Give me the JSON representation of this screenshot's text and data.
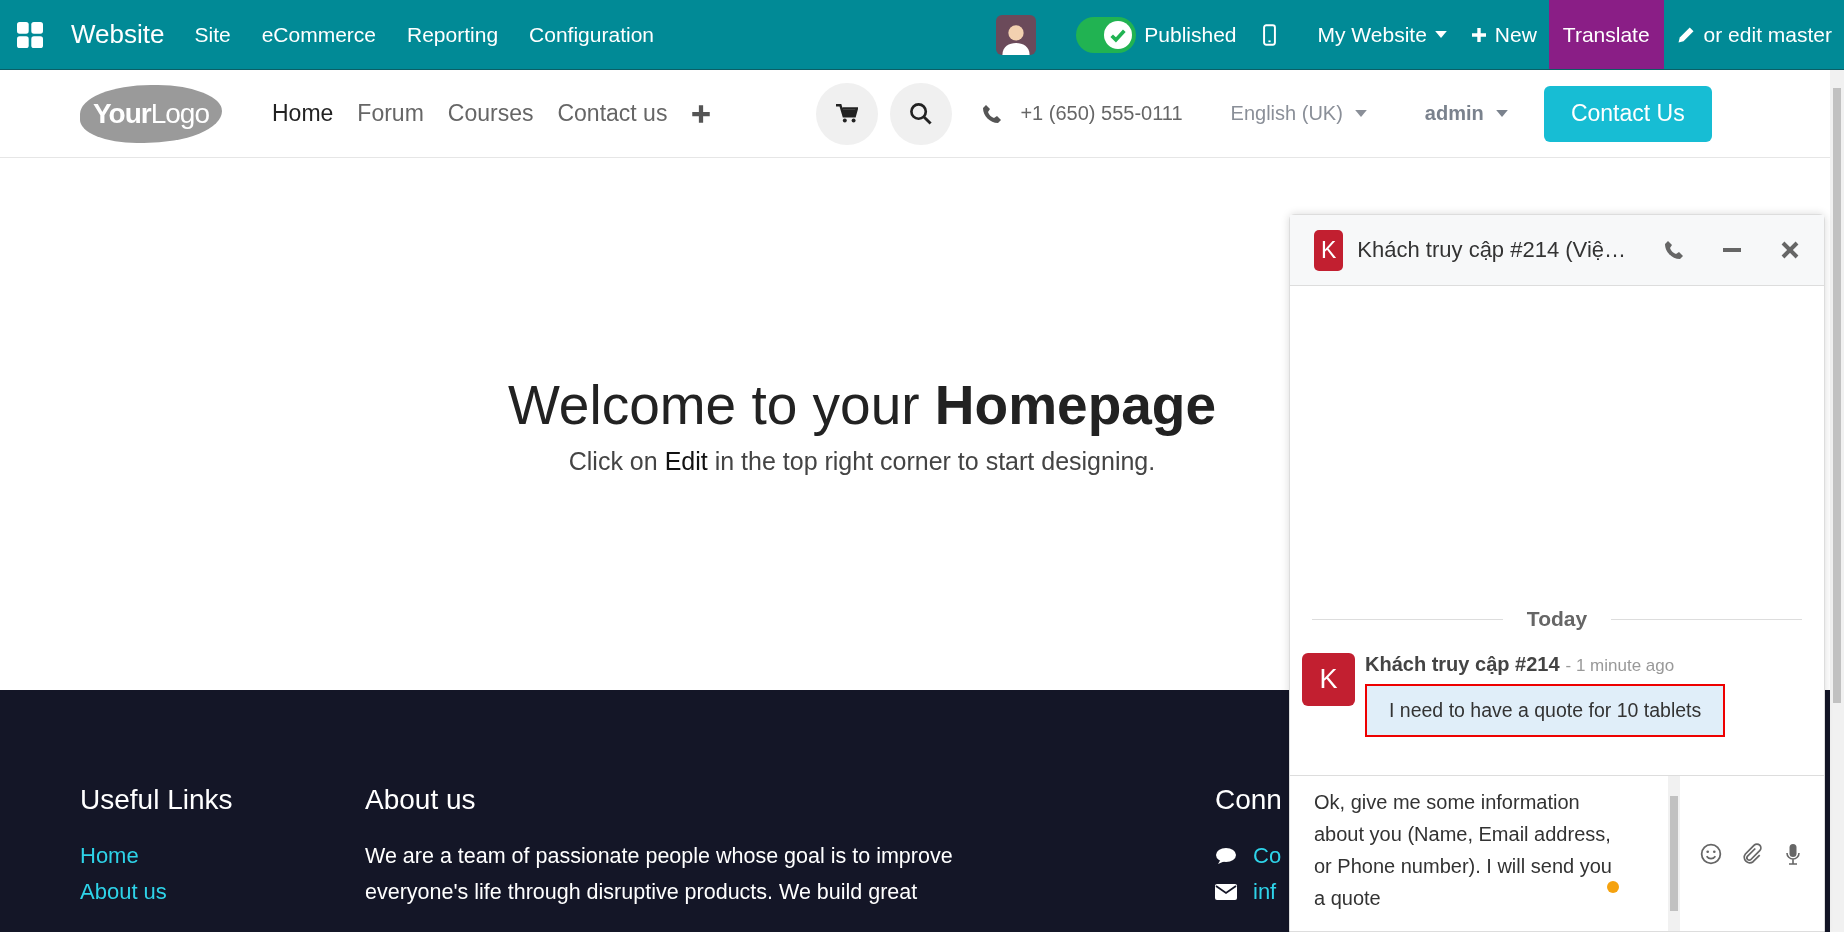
{
  "topbar": {
    "app_name": "Website",
    "menu": [
      "Site",
      "eCommerce",
      "Reporting",
      "Configuration"
    ],
    "published": {
      "label": "Published",
      "on": true
    },
    "website_selector": "My Website",
    "new_button": "New",
    "translate_button": "Translate",
    "edit_master_button": "or edit master"
  },
  "header": {
    "logo": "**Your**Logo",
    "nav": [
      {
        "label": "Home",
        "selected": true
      },
      {
        "label": "Forum",
        "selected": false
      },
      {
        "label": "Courses",
        "selected": false
      },
      {
        "label": "Contact us",
        "selected": false
      }
    ],
    "phone": "+1 (650) 555-0111",
    "language": "English (UK)",
    "user": "admin",
    "contact_button": "Contact Us"
  },
  "hero": {
    "title": "Welcome to your **Homepage**",
    "subtitle": "Click on **Edit** in the top right corner to start designing."
  },
  "footer": {
    "columns": [
      {
        "kind": "links",
        "heading": "Useful Links",
        "links": [
          "Home",
          "About us"
        ]
      },
      {
        "kind": "text",
        "heading": "About us",
        "text": "We are a team of passionate people whose goal is to improve everyone's life through disruptive products. We build great"
      },
      {
        "kind": "contacts",
        "heading": "Conn",
        "items": [
          {
            "kind": "chat",
            "text": "Co"
          },
          {
            "kind": "email",
            "text": "inf"
          }
        ]
      }
    ]
  },
  "chat": {
    "avatar": "K",
    "title": "Khách truy cập #214 (Việ…",
    "day_separator": "Today",
    "messages": [
      {
        "avatar": "K",
        "author": "Khách truy cập #214",
        "time": "- 1 minute ago",
        "text": "I need to have a quote for 10 tablets",
        "highlighted": true
      }
    ],
    "composer": {
      "value": "Ok, give me some information about you (Name, Email address, or Phone number). I will send you a quote"
    }
  }
}
